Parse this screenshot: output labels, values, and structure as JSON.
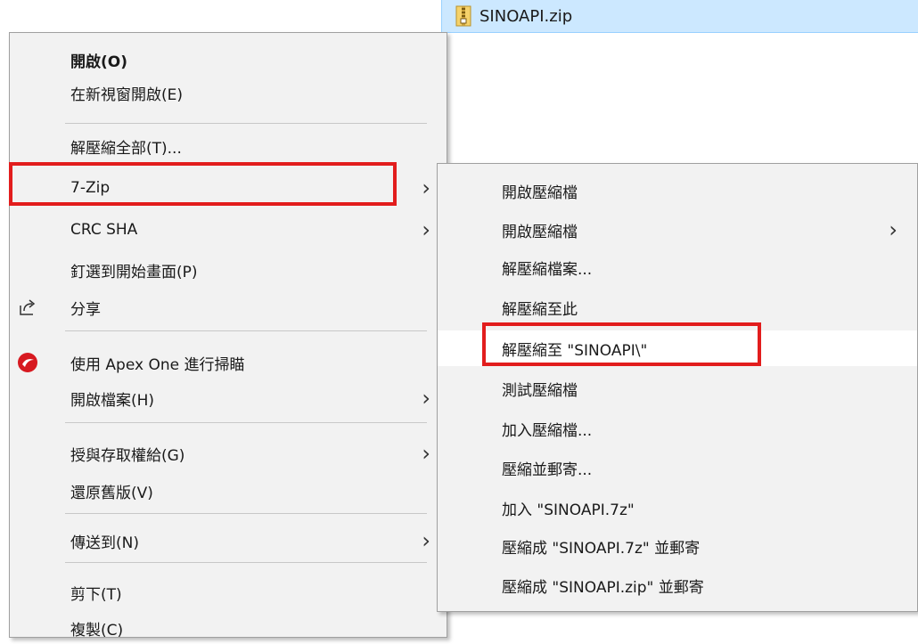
{
  "file": {
    "name": "SINOAPI.zip",
    "icon": "zip-archive-icon"
  },
  "context_menu": {
    "items": [
      {
        "label": "開啟(O)"
      },
      {
        "label": "在新視窗開啟(E)"
      },
      {
        "label": "解壓縮全部(T)..."
      },
      {
        "label": "7-Zip"
      },
      {
        "label": "CRC SHA"
      },
      {
        "label": "釘選到開始畫面(P)"
      },
      {
        "label": "分享",
        "icon": "share-icon"
      },
      {
        "label": "使用 Apex One 進行掃瞄",
        "icon": "apex-one-icon"
      },
      {
        "label": "開啟檔案(H)"
      },
      {
        "label": "授與存取權給(G)"
      },
      {
        "label": "還原舊版(V)"
      },
      {
        "label": "傳送到(N)"
      },
      {
        "label": "剪下(T)"
      },
      {
        "label": "複製(C)"
      }
    ]
  },
  "submenu_7zip": {
    "items": [
      {
        "label": "開啟壓縮檔"
      },
      {
        "label": "開啟壓縮檔"
      },
      {
        "label": "解壓縮檔案..."
      },
      {
        "label": "解壓縮至此"
      },
      {
        "label": "解壓縮至 \"SINOAPI\\\""
      },
      {
        "label": "測試壓縮檔"
      },
      {
        "label": "加入壓縮檔..."
      },
      {
        "label": "壓縮並郵寄..."
      },
      {
        "label": "加入 \"SINOAPI.7z\""
      },
      {
        "label": "壓縮成 \"SINOAPI.7z\" 並郵寄"
      },
      {
        "label": "壓縮成 \"SINOAPI.zip\" 並郵寄"
      }
    ]
  },
  "arrow_glyph": "›",
  "highlight_color": "#e21d1d"
}
